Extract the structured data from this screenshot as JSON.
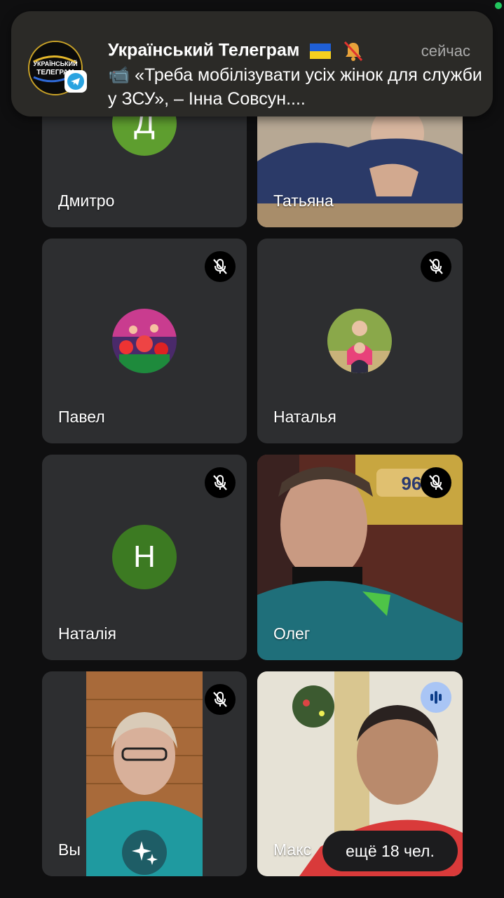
{
  "status_dot_color": "#22c55e",
  "notification": {
    "app": "Telegram",
    "channel_logo_text": "УКРАЇНСЬКИЙ ТЕЛЕГРАМ",
    "title": "Український Телеграм",
    "time": "сейчас",
    "body": "📹 «Треба мобілізувати усіх жінок для служби у ЗСУ», – Інна Совсун...."
  },
  "participants": [
    {
      "name": "Дмитро",
      "avatar": "letter",
      "letter": "Д",
      "avatar_color": "#5e9e2f",
      "muted": false
    },
    {
      "name": "Татьяна",
      "avatar": "video",
      "muted": false
    },
    {
      "name": "Павел",
      "avatar": "photo",
      "muted": true
    },
    {
      "name": "Наталья",
      "avatar": "photo",
      "muted": true
    },
    {
      "name": "Наталія",
      "avatar": "letter",
      "letter": "Н",
      "avatar_color": "#3c7a22",
      "muted": true
    },
    {
      "name": "Олег",
      "avatar": "video",
      "muted": true
    },
    {
      "name": "Вы",
      "avatar": "video",
      "muted": true
    },
    {
      "name": "Макс",
      "avatar": "video",
      "muted": false,
      "speaking": true
    }
  ],
  "more_participants": "ещё 18 чел.",
  "icons": {
    "mute": "mic-off-icon",
    "speaking": "audio-level-icon",
    "effects": "sparkle-effects-icon",
    "telegram": "telegram-icon",
    "flag": "ukraine-flag-icon",
    "bell_muted": "bell-muted-icon",
    "video": "video-camera-icon"
  }
}
